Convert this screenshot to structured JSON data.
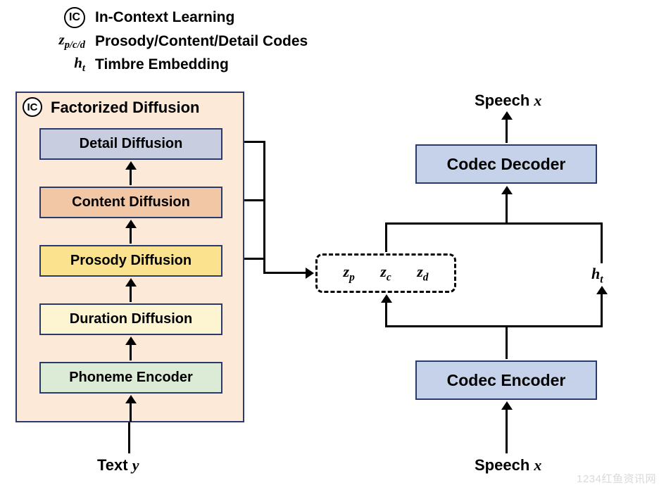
{
  "legend": {
    "ic": "IC",
    "ic_label": "In-Context Learning",
    "codes_sym_prefix": "z",
    "codes_sym_sub": "p/c/d",
    "codes_label": "Prosody/Content/Detail Codes",
    "timbre_sym_prefix": "h",
    "timbre_sym_sub": "t",
    "timbre_label": "Timbre Embedding"
  },
  "panel": {
    "badge": "IC",
    "title": "Factorized Diffusion",
    "blocks": {
      "detail": "Detail Diffusion",
      "content": "Content Diffusion",
      "prosody": "Prosody Diffusion",
      "duration": "Duration Diffusion",
      "phoneme": "Phoneme Encoder"
    }
  },
  "codes_box": {
    "zp_pre": "z",
    "zp_sub": "p",
    "zc_pre": "z",
    "zc_sub": "c",
    "zd_pre": "z",
    "zd_sub": "d"
  },
  "ht": {
    "pre": "h",
    "sub": "t"
  },
  "right": {
    "decoder": "Codec Decoder",
    "encoder": "Codec Encoder"
  },
  "io": {
    "text_y_pre": "Text ",
    "text_y_var": "y",
    "speech_x_out_pre": "Speech ",
    "speech_x_out_var": "x",
    "speech_x_in_pre": "Speech ",
    "speech_x_in_var": "x"
  },
  "watermark": "1234红鱼资讯网"
}
